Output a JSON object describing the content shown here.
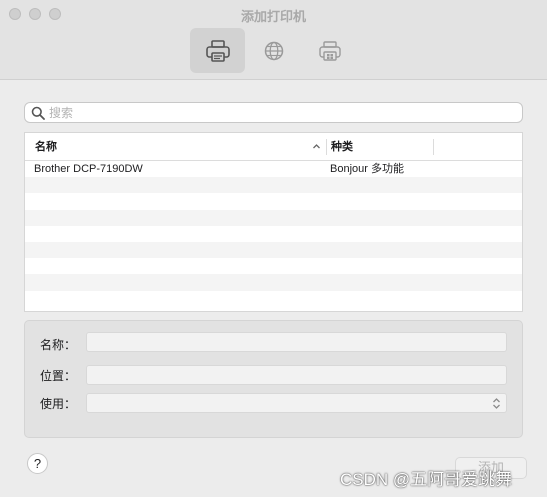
{
  "window": {
    "title": "添加打印机"
  },
  "toolbar": {
    "items": [
      {
        "icon": "printer-icon",
        "active": true
      },
      {
        "icon": "globe-icon",
        "active": false
      },
      {
        "icon": "windows-printer-icon",
        "active": false
      }
    ]
  },
  "search": {
    "placeholder": "搜索",
    "value": ""
  },
  "table": {
    "columns": [
      "名称",
      "种类"
    ],
    "sort_icon": "chevron-up-icon",
    "rows": [
      {
        "name": "Brother DCP-7190DW",
        "kind": "Bonjour 多功能"
      }
    ]
  },
  "details": {
    "name_label": "名称：",
    "location_label": "位置：",
    "use_label": "使用：",
    "name_value": "",
    "location_value": "",
    "use_value": ""
  },
  "footer": {
    "help_label": "?",
    "add_label": "添加",
    "watermark": "CSDN @五阿哥爱跳舞"
  }
}
